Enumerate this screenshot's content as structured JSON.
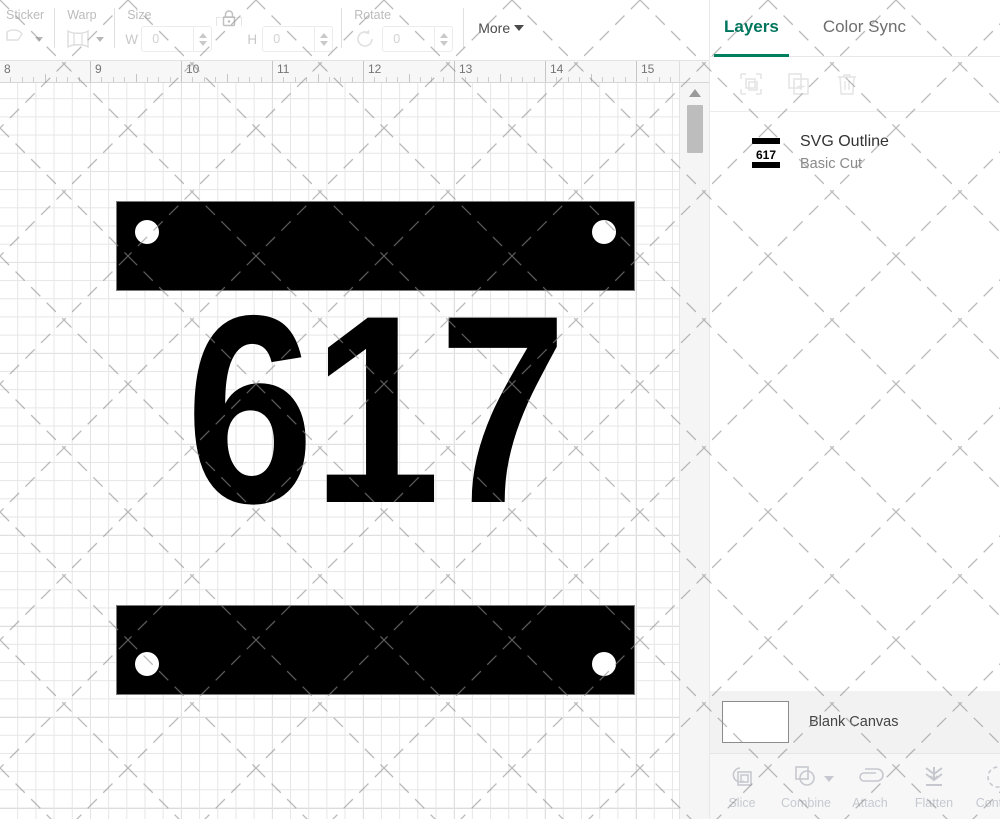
{
  "toolbar": {
    "groups": [
      {
        "label": "Sticker",
        "icon": "sticker-icon",
        "has_caret": true
      },
      {
        "label": "Warp",
        "icon": "warp-icon",
        "has_caret": true
      },
      {
        "label": "Size",
        "icon": "size-icon",
        "has_caret": false
      },
      {
        "label": "Rotate",
        "icon": "rotate-icon",
        "has_caret": false
      }
    ],
    "size": {
      "label": "Size",
      "width_letter": "W",
      "width_value": "0",
      "height_letter": "H",
      "height_value": "0",
      "lock_icon": "lock-icon"
    },
    "rotate": {
      "label": "Rotate",
      "value": "0",
      "icon": "rotate-icon"
    },
    "more_label": "More"
  },
  "ruler": {
    "unit_labels": [
      "8",
      "9",
      "10",
      "11",
      "12",
      "13",
      "14",
      "15"
    ]
  },
  "canvas": {
    "artwork": {
      "plate_number": "617",
      "fill_color": "#000000",
      "stroke_color": "#7a7a7a",
      "hole_count": 4
    },
    "scrollbar": {
      "up_arrow_icon": "chevron-up-icon"
    }
  },
  "right_panel": {
    "tabs": [
      {
        "label": "Layers",
        "active": true
      },
      {
        "label": "Color Sync",
        "active": false
      }
    ],
    "accent_color": "#00805f",
    "actions": [
      {
        "name": "group-icon",
        "enabled": false
      },
      {
        "name": "duplicate-icon",
        "enabled": false
      },
      {
        "name": "delete-icon",
        "enabled": false
      }
    ],
    "layers": [
      {
        "title": "SVG Outline",
        "subtitle": "Basic Cut",
        "thumbnail": "617"
      }
    ],
    "canvas_row": {
      "label": "Blank Canvas",
      "swatch_color": "#ffffff"
    },
    "bottom_tools": [
      {
        "label": "Slice",
        "icon": "slice-icon",
        "has_caret": false
      },
      {
        "label": "Combine",
        "icon": "combine-icon",
        "has_caret": true
      },
      {
        "label": "Attach",
        "icon": "attach-icon",
        "has_caret": false
      },
      {
        "label": "Flatten",
        "icon": "flatten-icon",
        "has_caret": false
      },
      {
        "label": "Contour",
        "icon": "contour-icon",
        "has_caret": false
      }
    ]
  }
}
